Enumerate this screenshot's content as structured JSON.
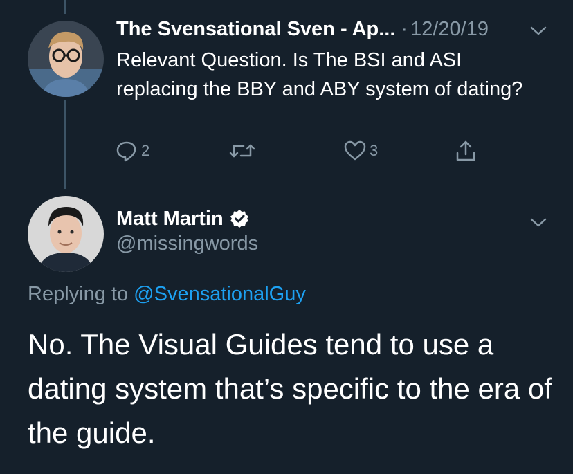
{
  "colors": {
    "background": "#15202b",
    "primary_text": "#ffffff",
    "secondary_text": "#8899a6",
    "link": "#1da1f2",
    "thread_line": "#3d5466"
  },
  "parent_tweet": {
    "author_name": "The Svensational Sven - Ap...",
    "separator": "·",
    "date": "12/20/19",
    "text": "Relevant Question. Is The BSI and ASI replacing the BBY and ABY system of dating?",
    "actions": {
      "reply_icon": "reply-icon",
      "reply_count": "2",
      "retweet_icon": "retweet-icon",
      "like_icon": "heart-icon",
      "like_count": "3",
      "share_icon": "share-icon"
    },
    "menu_icon": "chevron-down-icon"
  },
  "reply_tweet": {
    "author_name": "Matt Martin",
    "verified_icon": "verified-badge-icon",
    "handle": "@missingwords",
    "replying_prefix": "Replying to",
    "replying_handle": "@SvensationalGuy",
    "text": "No. The Visual Guides tend to use a dating system that’s specific to the era of the guide.",
    "menu_icon": "chevron-down-icon"
  }
}
